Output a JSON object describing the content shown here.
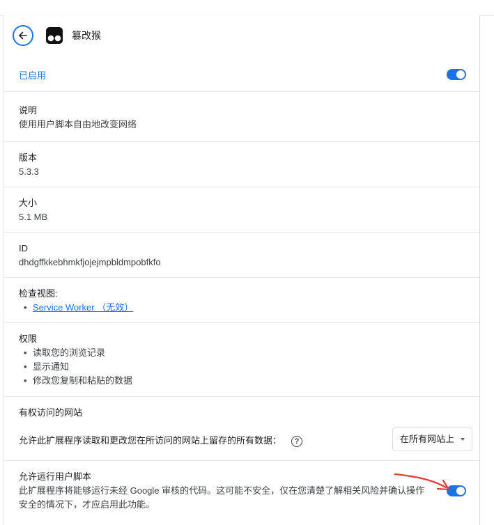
{
  "extension": {
    "name": "篡改猴",
    "enabled_label": "已启用",
    "enabled": true
  },
  "details": {
    "description": {
      "label": "说明",
      "value": "使用用户脚本自由地改变网络"
    },
    "version": {
      "label": "版本",
      "value": "5.3.3"
    },
    "size": {
      "label": "大小",
      "value": "5.1 MB"
    },
    "id": {
      "label": "ID",
      "value": "dhdgffkkebhmkfjojejmpbldmpobfkfo"
    },
    "inspect_views": {
      "label": "检查视图:",
      "link": "Service Worker （无效）"
    },
    "permissions": {
      "label": "权限",
      "items": [
        "读取您的浏览记录",
        "显示通知",
        "修改您复制和粘贴的数据"
      ]
    }
  },
  "site_access": {
    "title": "有权访问的网站",
    "description": "允许此扩展程序读取和更改您在所访问的网站上留存的所有数据：",
    "select_value": "在所有网站上"
  },
  "user_scripts": {
    "title": "允许运行用户脚本",
    "description": "此扩展程序将能够运行未经 Google 审核的代码。这可能不安全，仅在您清楚了解相关风险并确认操作安全的情况下，才应启用此功能。",
    "enabled": true
  },
  "colors": {
    "accent": "#1a73e8",
    "annotation": "#e53935"
  }
}
